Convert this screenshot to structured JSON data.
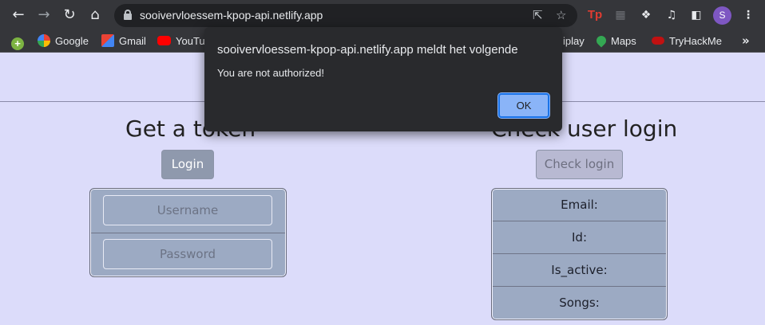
{
  "browser": {
    "url": "sooivervloessem-kpop-api.netlify.app",
    "avatar_initial": "S",
    "ext_tp_label": "Tp",
    "bookmarks": [
      {
        "label": "Google"
      },
      {
        "label": "Gmail"
      },
      {
        "label": "YouTube"
      },
      {
        "label": "iplay"
      },
      {
        "label": "Maps"
      },
      {
        "label": "TryHackMe"
      }
    ],
    "bookmarks_more": "»"
  },
  "login_section": {
    "title": "Get a token",
    "button_label": "Login",
    "username_placeholder": "Username",
    "password_placeholder": "Password"
  },
  "check_section": {
    "title": "Check user login",
    "button_label": "Check login",
    "rows": [
      "Email:",
      "Id:",
      "Is_active:",
      "Songs:"
    ]
  },
  "dialog": {
    "title": "sooivervloessem-kpop-api.netlify.app meldt het volgende",
    "message": "You are not authorized!",
    "ok_label": "OK"
  },
  "colors": {
    "page_bg": "#dcdcfa",
    "card_bg": "#9caac3",
    "dialog_bg": "#292a2d",
    "ok_button": "#8ab4f8"
  }
}
